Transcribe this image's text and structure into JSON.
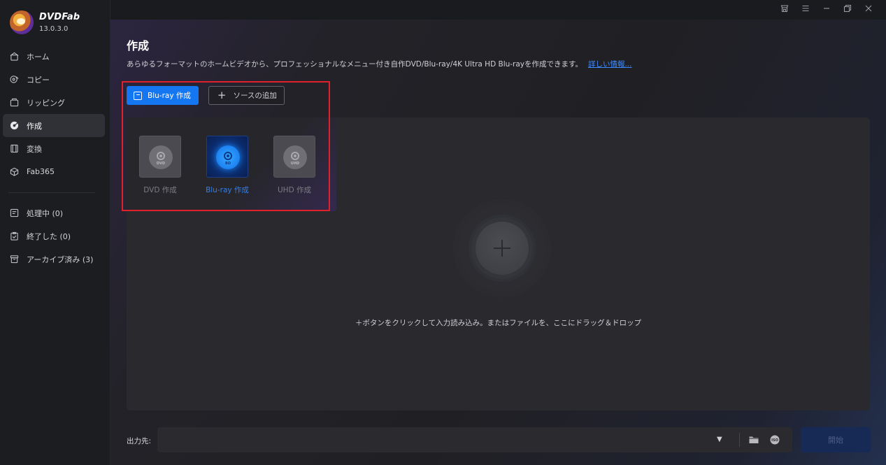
{
  "app": {
    "name": "DVDFab",
    "version": "13.0.3.0"
  },
  "sidebar": {
    "items": [
      {
        "label": "ホーム",
        "icon": "home-icon"
      },
      {
        "label": "コピー",
        "icon": "copy-icon"
      },
      {
        "label": "リッピング",
        "icon": "ripper-icon"
      },
      {
        "label": "作成",
        "icon": "creator-icon",
        "active": true
      },
      {
        "label": "変換",
        "icon": "film-icon"
      },
      {
        "label": "Fab365",
        "icon": "fab365-icon"
      }
    ],
    "status_items": [
      {
        "label": "処理中 (0)",
        "icon": "queue-icon"
      },
      {
        "label": "終了した (0)",
        "icon": "clipboard-icon"
      },
      {
        "label": "アーカイブ済み (3)",
        "icon": "archive-icon"
      }
    ]
  },
  "titlebar": {
    "icons": [
      "shop-icon",
      "menu-icon",
      "minimize-icon",
      "restore-icon",
      "close-icon"
    ]
  },
  "main": {
    "title": "作成",
    "description": "あらゆるフォーマットのホームビデオから、プロフェッショナルなメニュー付き自作DVD/Blu-ray/4K Ultra HD Blu-rayを作成できます。",
    "more_link": "詳しい情報..."
  },
  "toolbar": {
    "mode_button": "Blu-ray 作成",
    "add_source_button": "ソースの追加"
  },
  "type_selector": {
    "options": [
      {
        "label": "DVD 作成",
        "disc_tag": "DVD"
      },
      {
        "label": "Blu-ray 作成",
        "disc_tag": "BD",
        "selected": true
      },
      {
        "label": "UHD 作成",
        "disc_tag": "UHD"
      }
    ]
  },
  "dropzone": {
    "hint": "＋ボタンをクリックして入力読み込み。またはファイルを、ここにドラッグ＆ドロップ"
  },
  "output": {
    "label": "出力先:",
    "value": "",
    "start_button": "開始"
  },
  "colors": {
    "accent": "#1576f2",
    "highlight_border": "#e0212b",
    "background": "#1a1b1f"
  }
}
